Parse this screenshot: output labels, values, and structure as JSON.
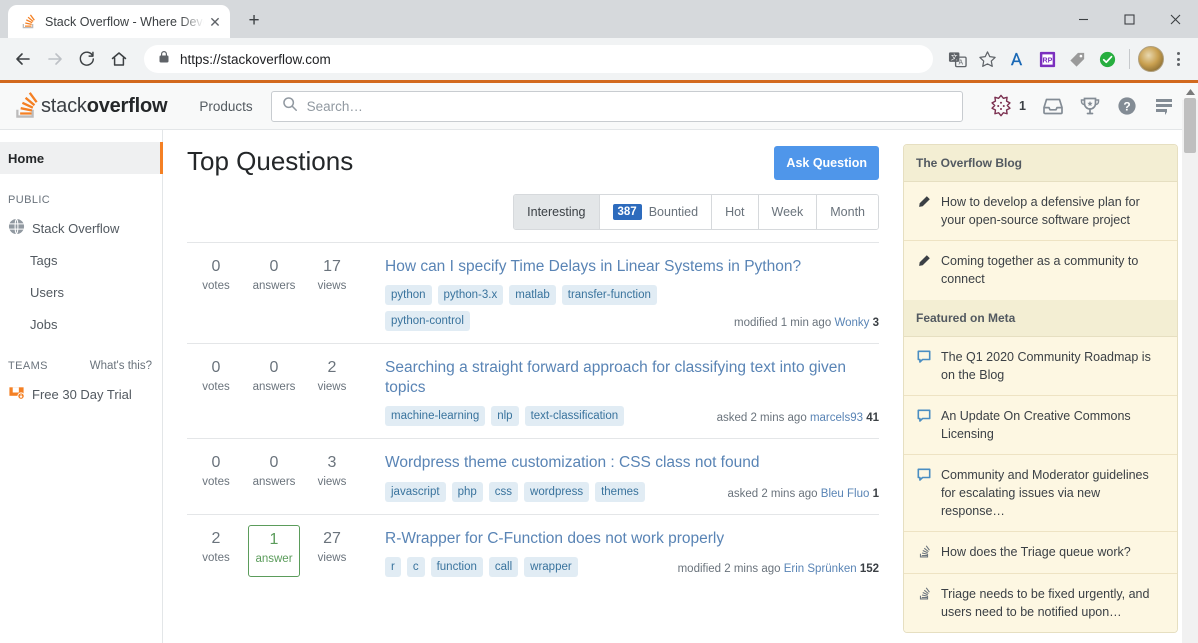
{
  "browser": {
    "tab": {
      "title": "Stack Overflow - Where Devel",
      "favicon": "stackoverflow-favicon",
      "close_label": "✕"
    },
    "new_tab_label": "+",
    "window_controls": {
      "minimize": "—",
      "maximize": "▢",
      "close": "✕"
    },
    "nav": {
      "back": "←",
      "forward": "→",
      "reload": "⟳",
      "home": "⌂"
    },
    "omnibox": {
      "lock": "lock-icon",
      "url": "https://stackoverflow.com"
    },
    "extensions": [
      "translate-icon",
      "bookmark-star-icon",
      "grammarly-icon",
      "rp-extension-icon",
      "tag-extension-icon",
      "green-check-extension-icon"
    ],
    "profile": "user-avatar",
    "menu": "chrome-menu-icon"
  },
  "site_header": {
    "logo_light": "stack",
    "logo_bold": "overflow",
    "products_label": "Products",
    "search_placeholder": "Search…",
    "reputation": "1",
    "icons": [
      "achievements-badge-icon",
      "inbox-icon",
      "trophy-icon",
      "help-icon",
      "site-switcher-icon"
    ]
  },
  "sidebar": {
    "home_label": "Home",
    "public_label": "PUBLIC",
    "public_items": [
      {
        "label": "Stack Overflow",
        "icon": "globe-icon",
        "indent": false
      },
      {
        "label": "Tags",
        "icon": "",
        "indent": true
      },
      {
        "label": "Users",
        "icon": "",
        "indent": true
      },
      {
        "label": "Jobs",
        "icon": "",
        "indent": true
      }
    ],
    "teams_label": "TEAMS",
    "whats_this_label": "What's this?",
    "teams_item": {
      "label": "Free 30 Day Trial",
      "icon": "teams-icon"
    }
  },
  "main": {
    "title": "Top Questions",
    "ask_button": "Ask Question",
    "tabs": [
      {
        "label": "Interesting",
        "badge": "",
        "active": true
      },
      {
        "label": "Bountied",
        "badge": "387",
        "active": false
      },
      {
        "label": "Hot",
        "badge": "",
        "active": false
      },
      {
        "label": "Week",
        "badge": "",
        "active": false
      },
      {
        "label": "Month",
        "badge": "",
        "active": false
      }
    ],
    "questions": [
      {
        "votes": "0",
        "votes_label": "votes",
        "answers": "0",
        "answers_label": "answers",
        "answers_accepted": false,
        "views": "17",
        "views_label": "views",
        "title": "How can I specify Time Delays in Linear Systems in Python?",
        "tags": [
          "python",
          "python-3.x",
          "matlab",
          "transfer-function",
          "python-control"
        ],
        "action": "modified",
        "time": "1 min ago",
        "user": "Wonky",
        "rep": "3"
      },
      {
        "votes": "0",
        "votes_label": "votes",
        "answers": "0",
        "answers_label": "answers",
        "answers_accepted": false,
        "views": "2",
        "views_label": "views",
        "title": "Searching a straight forward approach for classifying text into given topics",
        "tags": [
          "machine-learning",
          "nlp",
          "text-classification"
        ],
        "action": "asked",
        "time": "2 mins ago",
        "user": "marcels93",
        "rep": "41"
      },
      {
        "votes": "0",
        "votes_label": "votes",
        "answers": "0",
        "answers_label": "answers",
        "answers_accepted": false,
        "views": "3",
        "views_label": "views",
        "title": "Wordpress theme customization : CSS class not found",
        "tags": [
          "javascript",
          "php",
          "css",
          "wordpress",
          "themes"
        ],
        "action": "asked",
        "time": "2 mins ago",
        "user": "Bleu Fluo",
        "rep": "1"
      },
      {
        "votes": "2",
        "votes_label": "votes",
        "answers": "1",
        "answers_label": "answer",
        "answers_accepted": true,
        "views": "27",
        "views_label": "views",
        "title": "R-Wrapper for C-Function does not work properly",
        "tags": [
          "r",
          "c",
          "function",
          "call",
          "wrapper"
        ],
        "action": "modified",
        "time": "2 mins ago",
        "user": "Erin Sprünken",
        "rep": "152"
      }
    ]
  },
  "rail": {
    "blog": {
      "heading": "The Overflow Blog",
      "items": [
        {
          "icon": "pencil-icon",
          "text": "How to develop a defensive plan for your open-source software project"
        },
        {
          "icon": "pencil-icon",
          "text": "Coming together as a community to connect"
        }
      ]
    },
    "meta": {
      "heading": "Featured on Meta",
      "items": [
        {
          "icon": "speech-bubble-icon",
          "text": "The Q1 2020 Community Roadmap is on the Blog"
        },
        {
          "icon": "speech-bubble-icon",
          "text": "An Update On Creative Commons Licensing"
        },
        {
          "icon": "speech-bubble-icon",
          "text": "Community and Moderator guidelines for escalating issues via new response…"
        },
        {
          "icon": "stackoverflow-icon",
          "text": "How does the Triage queue work?"
        },
        {
          "icon": "stackoverflow-icon",
          "text": "Triage needs to be fixed urgently, and users need to be notified upon…"
        }
      ]
    }
  },
  "colors": {
    "accent_orange": "#f48024",
    "link_blue": "#5984b5",
    "button_blue": "#4f96ea",
    "badge_blue": "#2d6bbd",
    "tag_bg": "#e1ecf4",
    "rail_bg": "#fdf7e2",
    "accepted_green": "#5b9c5b"
  }
}
